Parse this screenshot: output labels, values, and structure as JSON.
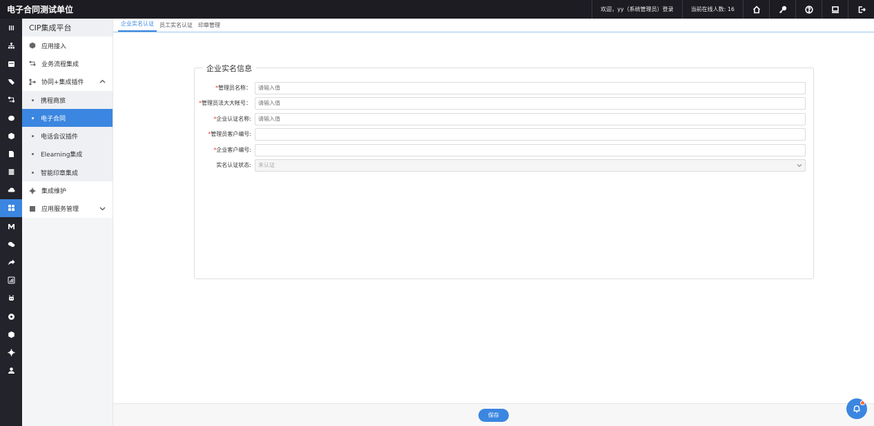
{
  "header": {
    "title": "电子合同测试单位",
    "welcome": "欢迎，yy（系统管理员）登录",
    "online_count": "当前在线人数: 16",
    "icons": [
      "home-icon",
      "key-icon",
      "help-icon",
      "monitor-icon",
      "logout-icon"
    ]
  },
  "rail": {
    "icons": [
      "menu-icon",
      "org-icon",
      "calendar-icon",
      "tag-icon",
      "flow-icon",
      "message-icon",
      "cube-icon",
      "doc-icon",
      "database-icon",
      "cloud-icon",
      "apps-icon",
      "gmail-icon",
      "wechat-icon",
      "share-icon",
      "chart-icon",
      "robot-icon",
      "globe-icon",
      "box-icon",
      "gear-icon",
      "user-icon"
    ],
    "active_index": 10
  },
  "sidebar": {
    "title": "CIP集成平台",
    "items": [
      {
        "label": "应用接入",
        "icon": "cube-icon"
      },
      {
        "label": "业务流程集成",
        "icon": "flow-icon"
      },
      {
        "label": "协同+集成插件",
        "icon": "branch-icon",
        "expanded": true
      }
    ],
    "sub_items": [
      {
        "label": "携程商旅"
      },
      {
        "label": "电子合同",
        "active": true
      },
      {
        "label": "电话会议插件"
      },
      {
        "label": "Elearning集成"
      },
      {
        "label": "智能印章集成"
      }
    ],
    "items_after": [
      {
        "label": "集成维护",
        "icon": "gear-icon"
      },
      {
        "label": "应用服务管理",
        "icon": "server-icon",
        "expandable": true
      }
    ]
  },
  "tabs": [
    {
      "label": "企业实名认证",
      "active": true
    },
    {
      "label": "员工实名认证"
    },
    {
      "label": "印章管理"
    }
  ],
  "form": {
    "legend": "企业实名信息",
    "fields": [
      {
        "required": "*",
        "label": "管理员名称：",
        "placeholder": "请输入值",
        "value": ""
      },
      {
        "required": "*",
        "label": "管理员法大大帐号：",
        "placeholder": "请输入值",
        "value": ""
      },
      {
        "required": "*",
        "label": "企业认证名称:",
        "placeholder": "请输入值",
        "value": ""
      },
      {
        "required": "*",
        "label": "管理员客户编号:",
        "placeholder": "",
        "value": ""
      },
      {
        "required": "*",
        "label": "企业客户编号:",
        "placeholder": "",
        "value": ""
      },
      {
        "required": "",
        "label": "实名认证状态:",
        "placeholder": "",
        "value": "未认证"
      }
    ]
  },
  "footer": {
    "save_label": "保存"
  },
  "colors": {
    "accent": "#3b86e0",
    "topbar": "#1c1c22",
    "rail": "#22232b"
  }
}
